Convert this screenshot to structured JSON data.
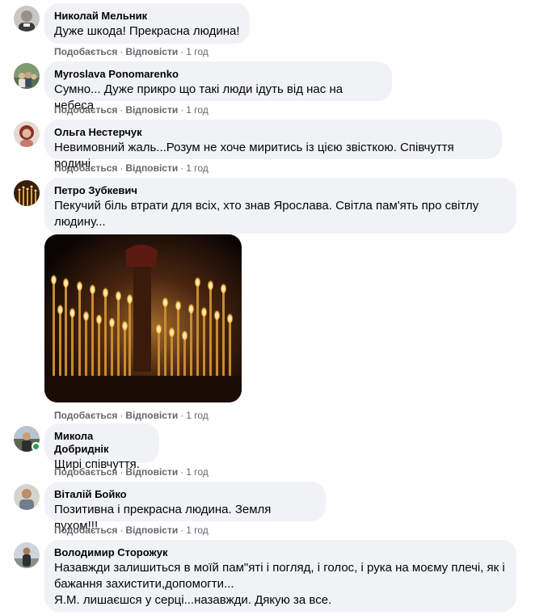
{
  "actions": {
    "like": "Подобається",
    "reply": "Відповісти",
    "separator": "·"
  },
  "comments": [
    {
      "author": "Николай Мельник",
      "text": [
        "Дуже шкода! Прекрасна людина!"
      ],
      "time": "1 год"
    },
    {
      "author": "Myroslava Ponomarenko",
      "text": [
        "Сумно... Дуже прикро що такі люди ідуть від нас на небеса"
      ],
      "time": "1 год"
    },
    {
      "author": "Ольга Нестерчук",
      "text": [
        "Невимовний жаль...Розум не хоче миритись із цією звісткою. Співчуття родині"
      ],
      "time": "1 год"
    },
    {
      "author": "Петро Зубкевич",
      "text": [
        "Пекучий біль втрати для всіх, хто знав Ярослава. Світла пам'ять про світлу",
        "людину..."
      ],
      "time": "1 год",
      "image": "candles-photo"
    },
    {
      "author": "Микола Добриднік",
      "text": [
        "Щирі співчуття."
      ],
      "time": "1 год",
      "online": true
    },
    {
      "author": "Віталій Бойко",
      "text": [
        "Позитивна і прекрасна людина. Земля пухом!!!"
      ],
      "time": "1 год"
    },
    {
      "author": "Володимир Сторожук",
      "text": [
        "Назавжди залишиться в моїй пам\"яті і погляд, і голос, і рука на моєму плечі, як і",
        "бажання захистити,допомогти...",
        "Я.М. лишаєшся у серці...назавжди. Дякую за все."
      ],
      "time": ""
    }
  ],
  "colors": {
    "bubble": "#f0f2f5",
    "meta": "#65676b",
    "online": "#31a24c"
  }
}
